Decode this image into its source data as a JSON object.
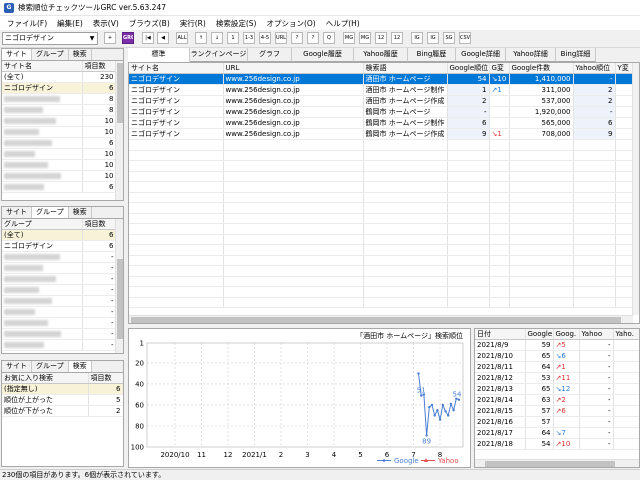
{
  "window": {
    "title": "検索順位チェックツールGRC  ver.5.63.247",
    "icon_text": "G"
  },
  "menu": [
    "ファイル(F)",
    "編集(E)",
    "表示(V)",
    "ブラウズ(B)",
    "実行(R)",
    "検索設定(S)",
    "オプション(O)",
    "ヘルプ(H)"
  ],
  "toolbar": {
    "site_select": "ニゴロデザイン",
    "buttons": [
      "+",
      "GRC",
      "|◀",
      "◀",
      "ALL",
      "↑",
      "↓",
      "1",
      "1-3",
      "4-5",
      "URL",
      "?",
      "?",
      "Q",
      "MG 1",
      "MG 1",
      "12",
      "12",
      "IG",
      "IG",
      "SG 1",
      "CSV UP"
    ]
  },
  "site_panel": {
    "tabs": [
      "サイト",
      "グループ",
      "検索"
    ],
    "headers": [
      "サイト名",
      "項目数"
    ],
    "rows": [
      {
        "name": "(全て)",
        "count": "230"
      },
      {
        "name": "ニゴロデザイン",
        "count": "6"
      },
      {
        "name": "",
        "count": "8"
      },
      {
        "name": "",
        "count": "8"
      },
      {
        "name": "",
        "count": "10"
      },
      {
        "name": "",
        "count": "10"
      },
      {
        "name": "",
        "count": "6"
      },
      {
        "name": "",
        "count": "10"
      },
      {
        "name": "",
        "count": "10"
      },
      {
        "name": "",
        "count": "10"
      },
      {
        "name": "",
        "count": "6"
      }
    ]
  },
  "group_panel": {
    "tabs": [
      "サイト",
      "グループ",
      "検索"
    ],
    "headers": [
      "グループ",
      "項目数"
    ],
    "rows": [
      {
        "name": "(全て)",
        "count": "6"
      },
      {
        "name": "ニゴロデザイン",
        "count": "6"
      },
      {
        "name": "",
        "count": "-"
      },
      {
        "name": "",
        "count": "-"
      },
      {
        "name": "",
        "count": "-"
      },
      {
        "name": "",
        "count": "-"
      },
      {
        "name": "",
        "count": "-"
      },
      {
        "name": "",
        "count": "-"
      },
      {
        "name": "",
        "count": "-"
      },
      {
        "name": "",
        "count": "-"
      },
      {
        "name": "",
        "count": "-"
      }
    ]
  },
  "search_panel": {
    "tabs": [
      "サイト",
      "グループ",
      "検索"
    ],
    "headers": [
      "お気に入り検索",
      "項目数"
    ],
    "rows": [
      {
        "name": "(指定無し)",
        "count": "6"
      },
      {
        "name": "順位が上がった",
        "count": "5"
      },
      {
        "name": "順位が下がった",
        "count": "2"
      }
    ]
  },
  "main_tabs": [
    "標準",
    "ランクインページ",
    "グラフ",
    "Google履歴",
    "Yahoo履歴",
    "Bing履歴",
    "Google詳細",
    "Yahoo詳細",
    "Bing詳細"
  ],
  "main_table": {
    "headers": [
      "サイト名",
      "URL",
      "検索語",
      "Google順位",
      "G変",
      "Google件数",
      "Yahoo順位",
      "Y変"
    ],
    "rows": [
      {
        "site": "ニゴロデザイン",
        "url": "www.256design.co.jp",
        "keyword": "酒田市 ホームページ",
        "g_rank": "54",
        "g_change": "↘10",
        "g_count": "1,410,000",
        "y_rank": "-",
        "selected": true
      },
      {
        "site": "ニゴロデザイン",
        "url": "www.256design.co.jp",
        "keyword": "酒田市 ホームページ制作",
        "g_rank": "1",
        "g_change": "↗1",
        "g_count": "311,000",
        "y_rank": "2",
        "selected": false
      },
      {
        "site": "ニゴロデザイン",
        "url": "www.256design.co.jp",
        "keyword": "酒田市 ホームページ作成",
        "g_rank": "2",
        "g_change": "",
        "g_count": "537,000",
        "y_rank": "2",
        "selected": false
      },
      {
        "site": "ニゴロデザイン",
        "url": "www.256design.co.jp",
        "keyword": "鶴岡市 ホームページ",
        "g_rank": "-",
        "g_change": "",
        "g_count": "1,920,000",
        "y_rank": "-",
        "selected": false
      },
      {
        "site": "ニゴロデザイン",
        "url": "www.256design.co.jp",
        "keyword": "鶴岡市 ホームページ制作",
        "g_rank": "6",
        "g_change": "",
        "g_count": "565,000",
        "y_rank": "6",
        "selected": false
      },
      {
        "site": "ニゴロデザイン",
        "url": "www.256design.co.jp",
        "keyword": "鶴岡市 ホームページ作成",
        "g_rank": "9",
        "g_change": "↘1",
        "g_count": "708,000",
        "y_rank": "9",
        "selected": false
      }
    ]
  },
  "chart_data": {
    "type": "line",
    "title": "「酒田市 ホームページ」検索順位",
    "y_ticks": [
      "1",
      "20",
      "40",
      "60",
      "80",
      "100"
    ],
    "x_ticks": [
      "2020/10",
      "11",
      "12",
      "2021/1",
      "2",
      "3",
      "4",
      "5",
      "6",
      "7",
      "8"
    ],
    "ylim": [
      1,
      100
    ],
    "y_inverted": true,
    "grid": true,
    "legend_position": "bottom-right",
    "series": [
      {
        "name": "Google",
        "color": "#4a7fd4",
        "values": [
          30,
          51,
          50,
          89,
          62,
          60,
          70,
          65,
          74,
          60,
          66,
          70,
          59,
          65,
          54,
          55
        ],
        "point_labels": [
          {
            "index": 1,
            "text": "51"
          },
          {
            "index": 3,
            "text": "89"
          },
          {
            "index": 15,
            "text": "54"
          }
        ]
      },
      {
        "name": "Yahoo",
        "color": "#e05050",
        "values": []
      }
    ]
  },
  "history_table": {
    "headers": [
      "日付",
      "Google",
      "Goog.",
      "Yahoo",
      "Yaho."
    ],
    "rows": [
      {
        "date": "2021/8/9",
        "google": "59",
        "gchg": "↗5",
        "yahoo": "-"
      },
      {
        "date": "2021/8/10",
        "google": "65",
        "gchg": "↘6",
        "yahoo": "-"
      },
      {
        "date": "2021/8/11",
        "google": "64",
        "gchg": "↗1",
        "yahoo": "-"
      },
      {
        "date": "2021/8/12",
        "google": "53",
        "gchg": "↗11",
        "yahoo": "-"
      },
      {
        "date": "2021/8/13",
        "google": "65",
        "gchg": "↘12",
        "yahoo": "-"
      },
      {
        "date": "2021/8/14",
        "google": "63",
        "gchg": "↗2",
        "yahoo": "-"
      },
      {
        "date": "2021/8/15",
        "google": "57",
        "gchg": "↗6",
        "yahoo": "-"
      },
      {
        "date": "2021/8/16",
        "google": "57",
        "gchg": "",
        "yahoo": "-"
      },
      {
        "date": "2021/8/17",
        "google": "64",
        "gchg": "↘7",
        "yahoo": "-"
      },
      {
        "date": "2021/8/18",
        "google": "54",
        "gchg": "↗10",
        "yahoo": "-"
      }
    ]
  },
  "status": "230個の項目があります。6個が表示されています。",
  "colors": {
    "selection": "#0078d7",
    "highlight": "#f7f2d8",
    "accent": "#7a2ea8"
  }
}
